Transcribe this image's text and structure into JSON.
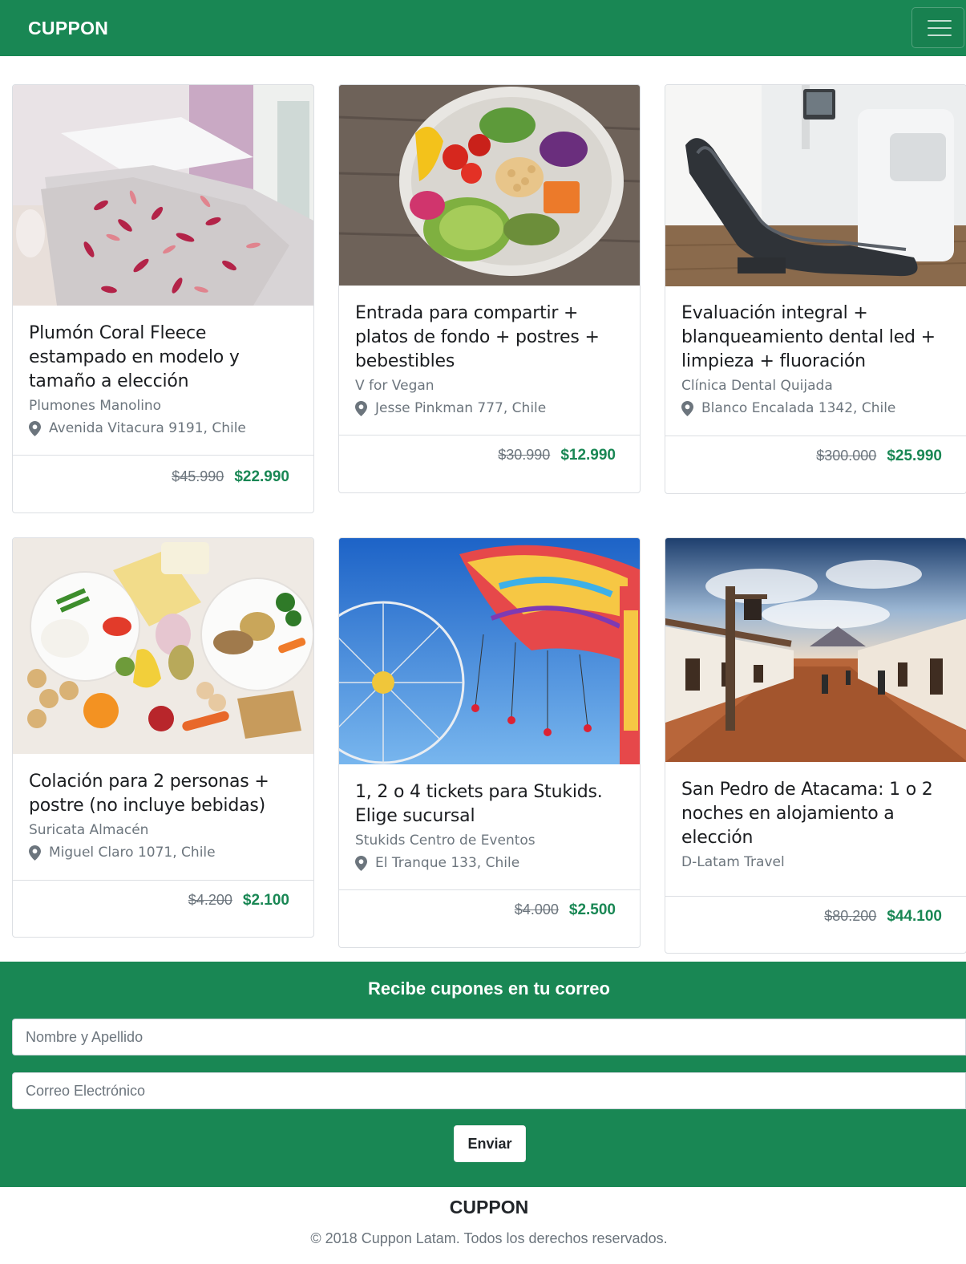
{
  "navbar": {
    "brand": "CUPPON",
    "menu_icon": "hamburger-menu-icon"
  },
  "cards": [
    {
      "title": "Plumón Coral Fleece estampado en modelo y tamaño a elección",
      "merchant": "Plumones Manolino",
      "address": "Avenida Vitacura 9191, Chile",
      "old_price": "$45.990",
      "new_price": "$22.990",
      "image": "bedroom-comforter-photo"
    },
    {
      "title": "Entrada para compartir + platos de fondo + postres + bebestibles",
      "merchant": "V for Vegan",
      "address": "Jesse Pinkman 777, Chile",
      "old_price": "$30.990",
      "new_price": "$12.990",
      "image": "vegan-salad-bowl-photo"
    },
    {
      "title": "Evaluación integral + blanqueamiento dental led + limpieza + fluoración",
      "merchant": "Clínica Dental Quijada",
      "address": "Blanco Encalada 1342, Chile",
      "old_price": "$300.000",
      "new_price": "$25.990",
      "image": "dental-chair-photo"
    },
    {
      "title": "Colación para 2 personas + postre (no incluye bebidas)",
      "merchant": "Suricata Almacén",
      "address": "Miguel Claro 1071, Chile",
      "old_price": "$4.200",
      "new_price": "$2.100",
      "image": "snack-platter-photo"
    },
    {
      "title": "1, 2 o 4 tickets para Stukids. Elige sucursal",
      "merchant": "Stukids Centro de Eventos",
      "address": "El Tranque 133, Chile",
      "old_price": "$4.000",
      "new_price": "$2.500",
      "image": "amusement-park-rides-photo"
    },
    {
      "title": "San Pedro de Atacama: 1 o 2 noches en alojamiento a elección",
      "merchant": "D-Latam Travel",
      "address": "",
      "old_price": "$80.200",
      "new_price": "$44.100",
      "image": "san-pedro-street-photo"
    }
  ],
  "subscribe": {
    "title": "Recibe cupones en tu correo",
    "name_placeholder": "Nombre y Apellido",
    "email_placeholder": "Correo Electrónico",
    "submit_label": "Enviar"
  },
  "footer": {
    "brand": "CUPPON",
    "copyright": "© 2018 Cuppon Latam. Todos los derechos reservados."
  },
  "colors": {
    "brand_green": "#198754",
    "muted_text": "#6c757d",
    "border": "#dcdfe3"
  }
}
